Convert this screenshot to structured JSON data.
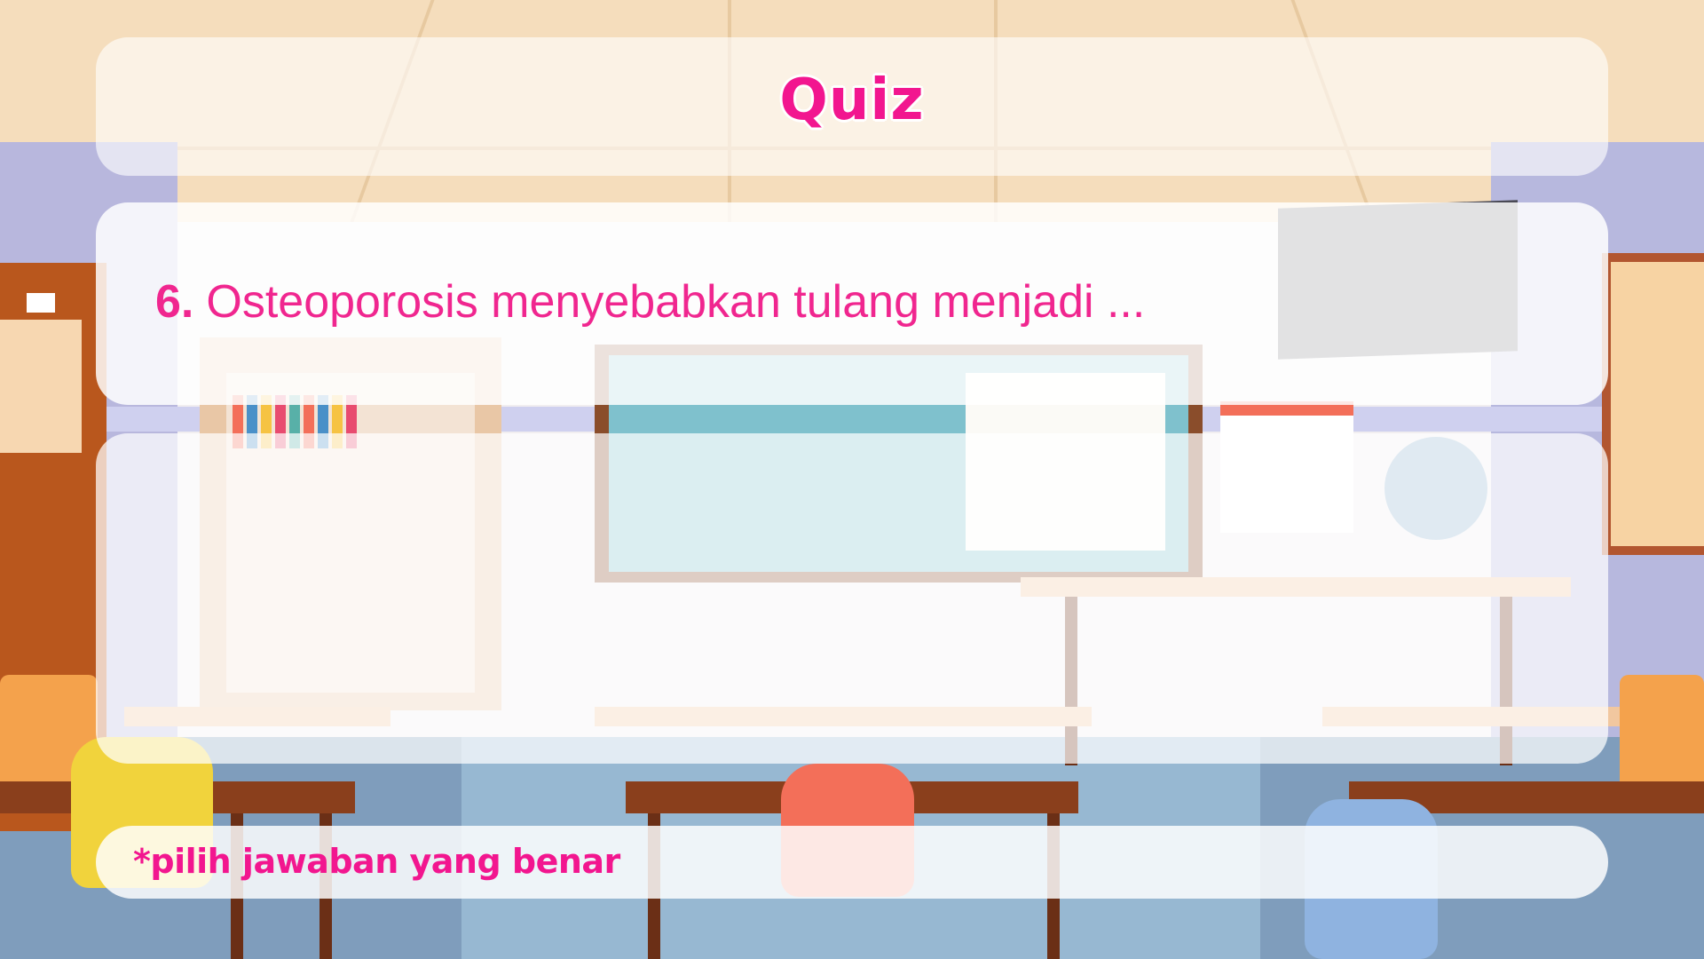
{
  "quiz": {
    "title": "Quiz",
    "question_number": "6.",
    "question_text": "Osteoporosis menyebabkan tulang menjadi ...",
    "hint": "*pilih jawaban yang benar"
  },
  "theme": {
    "accent": "#f2168f",
    "panel": "#ffffff"
  }
}
